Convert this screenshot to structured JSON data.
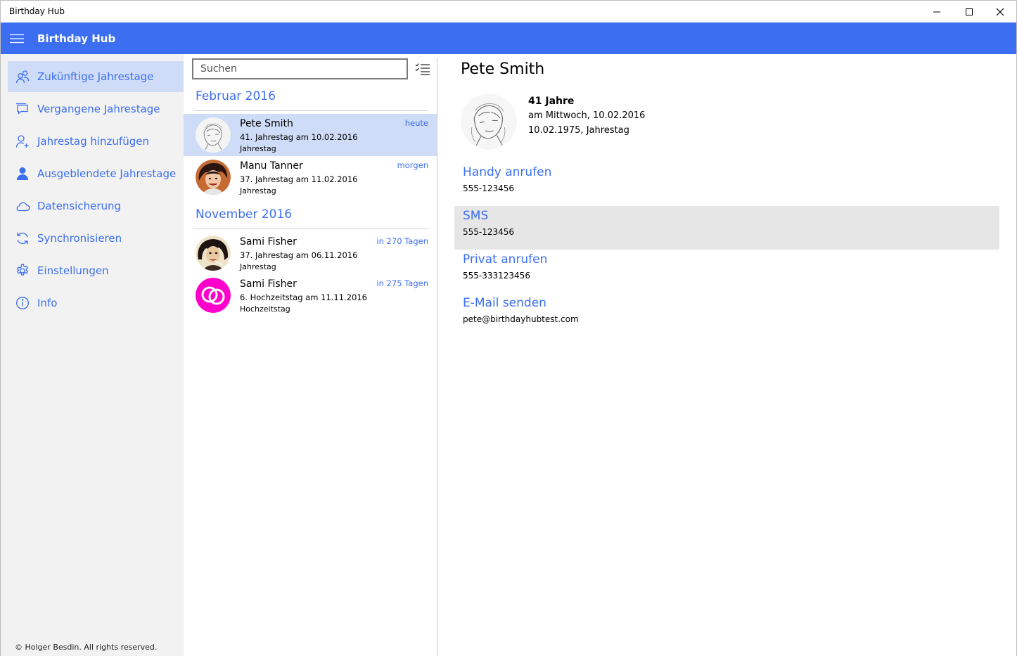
{
  "window": {
    "title": "Birthday Hub"
  },
  "app": {
    "title": "Birthday Hub"
  },
  "nav": {
    "items": [
      {
        "label": "Zukünftige Jahrestage",
        "icon": "people-icon",
        "active": true
      },
      {
        "label": "Vergangene Jahrestage",
        "icon": "chat-icon",
        "active": false
      },
      {
        "label": "Jahrestag hinzufügen",
        "icon": "add-person-icon",
        "active": false
      },
      {
        "label": "Ausgeblendete Jahrestage",
        "icon": "person-filled-icon",
        "active": false
      },
      {
        "label": "Datensicherung",
        "icon": "cloud-icon",
        "active": false
      },
      {
        "label": "Synchronisieren",
        "icon": "sync-icon",
        "active": false
      },
      {
        "label": "Einstellungen",
        "icon": "gear-icon",
        "active": false
      },
      {
        "label": "Info",
        "icon": "info-icon",
        "active": false
      }
    ],
    "copyright": "© Holger Besdin. All rights reserved."
  },
  "list": {
    "search_placeholder": "Suchen",
    "groups": [
      {
        "header": "Februar 2016",
        "rows": [
          {
            "name": "Pete Smith",
            "line1": "41. Jahrestag am 10.02.2016",
            "line2": "Jahrestag",
            "when": "heute",
            "selected": true
          },
          {
            "name": "Manu Tanner",
            "line1": "37. Jahrestag am 11.02.2016",
            "line2": "Jahrestag",
            "when": "morgen",
            "selected": false
          }
        ]
      },
      {
        "header": "November 2016",
        "rows": [
          {
            "name": "Sami Fisher",
            "line1": "37. Jahrestag am 06.11.2016",
            "line2": "Jahrestag",
            "when": "in 270 Tagen",
            "selected": false
          },
          {
            "name": "Sami Fisher",
            "line1": "6. Hochzeitstag am 11.11.2016",
            "line2": "Hochzeitstag",
            "when": "in 275 Tagen",
            "selected": false
          }
        ]
      }
    ]
  },
  "detail": {
    "name": "Pete Smith",
    "age": "41 Jahre",
    "weekday_line": "am Mittwoch, 10.02.2016",
    "origin_line": "10.02.1975, Jahrestag",
    "actions": [
      {
        "label": "Handy anrufen",
        "value": "555-123456"
      },
      {
        "label": "SMS",
        "value": "555-123456"
      },
      {
        "label": "Privat anrufen",
        "value": "555-333123456"
      },
      {
        "label": "E-Mail senden",
        "value": "pete@birthdayhubtest.com"
      }
    ]
  },
  "colors": {
    "accent": "#3b6ef0",
    "selection": "#cfdcf7",
    "nav_bg": "#f2f2f2",
    "hover_bg": "#e6e6e6",
    "wedding_icon": "#ff00cc"
  }
}
